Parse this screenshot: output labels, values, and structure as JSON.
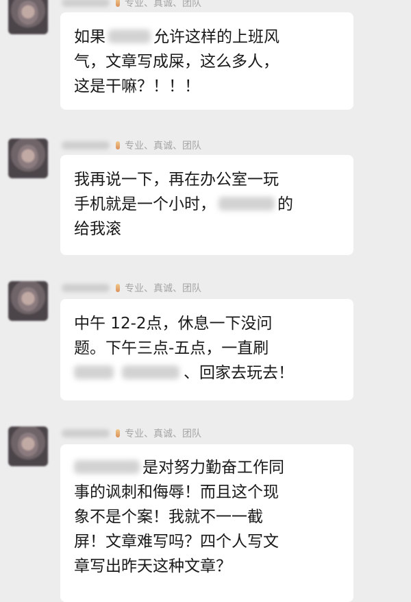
{
  "chat": {
    "messages": [
      {
        "sender_tag": "专业、真诚、团队",
        "lines": [
          "如果",
          "允许这样的上班风",
          "气，文章写成屎，这么多人，",
          "这是干嘛？！！！"
        ]
      },
      {
        "sender_tag": "专业、真诚、团队",
        "lines": [
          "我再说一下，再在办公室一玩",
          "手机就是一个小时，",
          "的",
          "给我滚"
        ]
      },
      {
        "sender_tag": "专业、真诚、团队",
        "lines": [
          "中午 12-2点，休息一下没问",
          "题。下午三点-五点，一直刷",
          "、回家去玩去！"
        ]
      },
      {
        "sender_tag": "专业、真诚、团队",
        "lines": [
          "是对努力勤奋工作同",
          "事的讽刺和侮辱！而且这个现",
          "象不是个案！我就不一一截",
          "屏！文章难写吗？四个人写文",
          "章写出昨天这种文章？"
        ]
      }
    ]
  }
}
